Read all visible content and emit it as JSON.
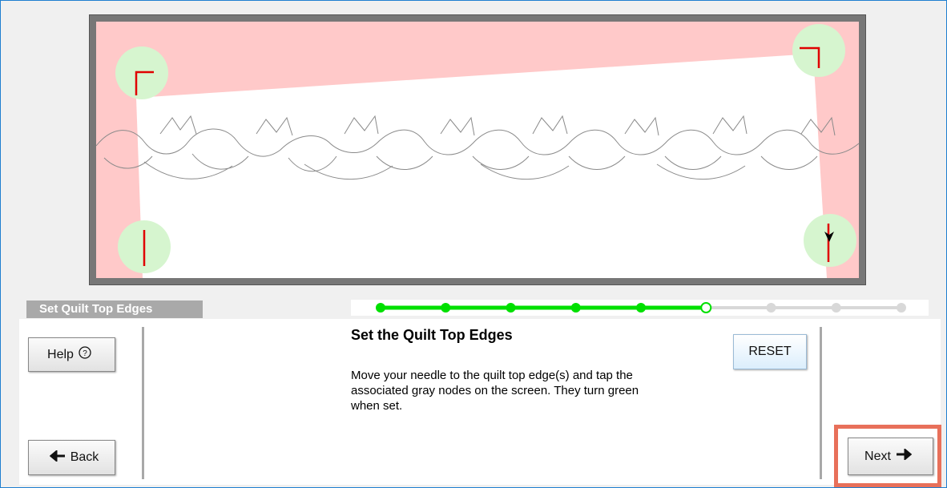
{
  "step_label": "Set Quilt Top Edges",
  "content": {
    "title": "Set the Quilt Top Edges",
    "instructions": "Move your needle to the quilt top edge(s) and tap the associated gray nodes on the screen. They turn green when set."
  },
  "buttons": {
    "help": "Help",
    "back": "Back",
    "reset": "RESET",
    "next": "Next"
  },
  "progress": {
    "total_steps": 9,
    "completed_steps": 5,
    "current_step": 6
  },
  "colors": {
    "progress_done": "#00e000",
    "progress_todo": "#d8d8d8",
    "quilt_background": "#ffc9c9",
    "node_fill": "#d6f5cf",
    "node_marker": "#e00000",
    "highlight": "#e8705a"
  },
  "icons": {
    "help": "question-circle-icon",
    "back": "arrow-left-icon",
    "next": "arrow-right-icon"
  }
}
